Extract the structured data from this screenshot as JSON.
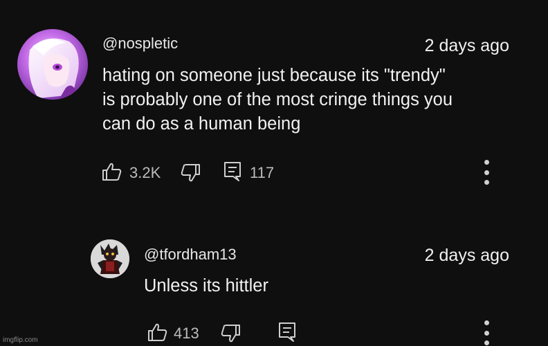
{
  "comment": {
    "handle": "@nospletic",
    "timestamp": "2 days ago",
    "text": "hating on someone just because its \"trendy\"|is probably one of the most cringe things you|can do as a human being",
    "likes": "3.2K",
    "replies": "117",
    "icons": [
      "like-icon",
      "dislike-icon",
      "replies-icon",
      "more-options-icon"
    ]
  },
  "reply": {
    "handle": "@tfordham13",
    "timestamp": "2 days ago",
    "text": "Unless its hittler",
    "likes": "413",
    "icons": [
      "like-icon",
      "dislike-icon",
      "replies-icon",
      "more-options-icon"
    ]
  },
  "watermark": "imgflip.com",
  "colors": {
    "background": "#0f0f0f",
    "text": "#f1f1f1",
    "secondary": "#bcbcbc"
  }
}
